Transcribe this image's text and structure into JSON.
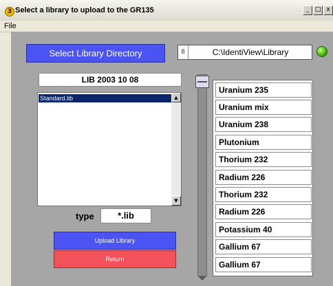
{
  "window": {
    "title": "Select a library to upload to the GR135",
    "app_icon_glyph": "3",
    "controls": [
      "_",
      "□",
      "x"
    ]
  },
  "menu": {
    "file": "File"
  },
  "select_directory_button": "Select Library Directory",
  "directory_path": {
    "indicator": "8",
    "value": "C:\\IdentiView\\Library"
  },
  "status_led": {
    "color": "#3fb20a",
    "state": "on"
  },
  "library_name": "LIB 2003 10 08",
  "file_list": {
    "items": [
      "Standard.lib"
    ],
    "selected_index": 0
  },
  "type_filter": {
    "label": "type",
    "value": "*.lib"
  },
  "upload_button": "Upload Library",
  "return_button": "Return",
  "isotope_slider": {
    "position": 0
  },
  "isotopes": [
    "Uranium 235",
    "Uranium mix",
    "Uranium 238",
    "Plutonium",
    "Thorium 232",
    "Radium 226",
    "Thorium 232",
    "Radium 226",
    "Potassium 40",
    "Gallium 67",
    "Gallium 67"
  ],
  "colors": {
    "blue_button": "#4b54f2",
    "red_button": "#f4525a",
    "panel": "#a6a6a6",
    "selection": "#0a246a"
  }
}
